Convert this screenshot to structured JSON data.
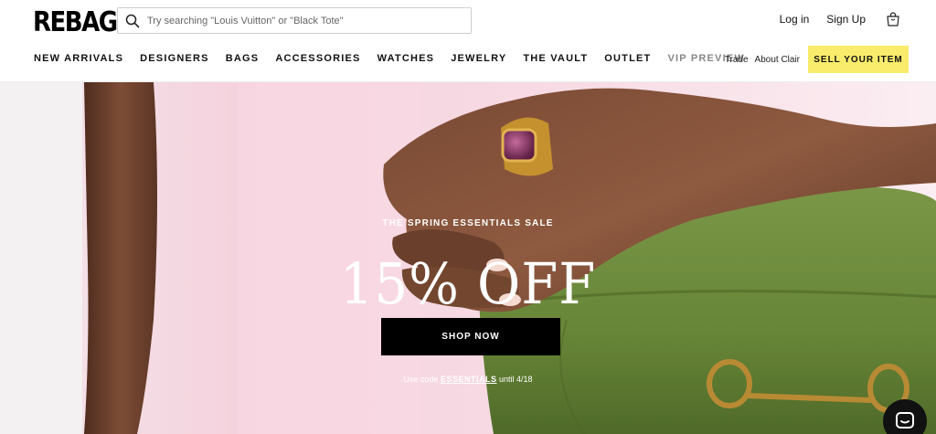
{
  "brand": {
    "logo": "REBAG"
  },
  "search": {
    "placeholder": "Try searching \"Louis Vuitton\" or \"Black Tote\""
  },
  "account": {
    "login": "Log in",
    "signup": "Sign Up",
    "cart_icon": "shopping-bag-icon"
  },
  "nav": {
    "items": [
      {
        "label": "NEW ARRIVALS"
      },
      {
        "label": "DESIGNERS"
      },
      {
        "label": "BAGS"
      },
      {
        "label": "ACCESSORIES"
      },
      {
        "label": "WATCHES"
      },
      {
        "label": "JEWELRY"
      },
      {
        "label": "THE VAULT"
      },
      {
        "label": "OUTLET"
      },
      {
        "label": "VIP PREVIEW"
      }
    ],
    "trade": "Trade",
    "about": "About Clair",
    "sell": "SELL YOUR ITEM"
  },
  "hero": {
    "eyebrow": "THE SPRING ESSENTIALS SALE",
    "headline": "15% OFF",
    "cta": "SHOP NOW",
    "promo_prefix": "Use code ",
    "promo_code": "ESSENTIALS",
    "promo_suffix": " until 4/18"
  },
  "colors": {
    "accent": "#f9ec6c",
    "cta_bg": "#000000",
    "hero_pink": "#f6dbe5",
    "bag_green": "#6d8a3e"
  },
  "icons": {
    "search": "search-icon",
    "chat": "chat-icon"
  }
}
